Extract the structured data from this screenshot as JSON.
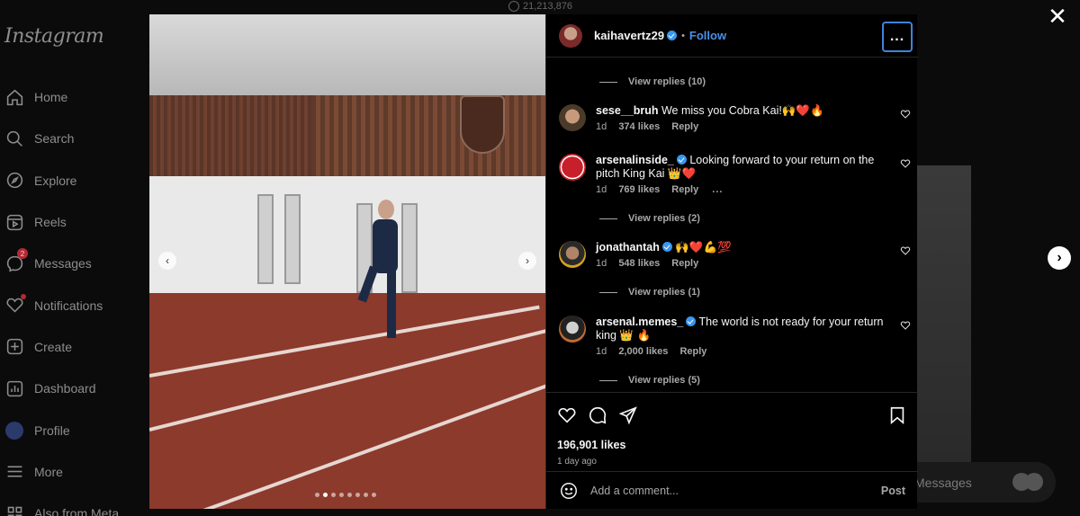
{
  "sidebar": {
    "logo": "Instagram",
    "items": [
      {
        "label": "Home",
        "icon": "home-icon"
      },
      {
        "label": "Search",
        "icon": "search-icon"
      },
      {
        "label": "Explore",
        "icon": "compass-icon"
      },
      {
        "label": "Reels",
        "icon": "reels-icon"
      },
      {
        "label": "Messages",
        "icon": "messenger-icon",
        "badge": "2"
      },
      {
        "label": "Notifications",
        "icon": "heart-icon"
      },
      {
        "label": "Create",
        "icon": "plus-square-icon"
      },
      {
        "label": "Dashboard",
        "icon": "chart-icon"
      },
      {
        "label": "Profile",
        "icon": "avatar"
      },
      {
        "label": "More",
        "icon": "menu-icon"
      },
      {
        "label": "Also from Meta",
        "icon": "meta-icon"
      }
    ]
  },
  "background": {
    "top_count": "21,213,876",
    "messages_label": "Messages"
  },
  "post": {
    "username": "kaihavertz29",
    "follow_label": "Follow",
    "more_label": "...",
    "likes": "196,901 likes",
    "time": "1 day ago",
    "add_comment_placeholder": "Add a comment...",
    "post_label": "Post",
    "carousel_count": 8,
    "carousel_active": 2
  },
  "comments": {
    "replies_top": "View replies (10)",
    "items": [
      {
        "username": "sese__bruh",
        "verified": false,
        "text": "We miss you Cobra Kai!🙌❤️🔥",
        "time": "1d",
        "likes": "374 likes",
        "reply": "Reply",
        "replies": null
      },
      {
        "username": "arsenalinside_",
        "verified": true,
        "text": "Looking forward to your return on the pitch King Kai 👑❤️",
        "time": "1d",
        "likes": "769 likes",
        "reply": "Reply",
        "more": "...",
        "replies": "View replies (2)"
      },
      {
        "username": "jonathantah",
        "verified": true,
        "text": "🙌❤️💪💯",
        "time": "1d",
        "likes": "548 likes",
        "reply": "Reply",
        "replies": "View replies (1)"
      },
      {
        "username": "arsenal.memes_",
        "verified": true,
        "text": "The world is not ready for your return king 👑 🔥",
        "time": "1d",
        "likes": "2,000 likes",
        "reply": "Reply",
        "replies": "View replies (5)"
      }
    ]
  }
}
